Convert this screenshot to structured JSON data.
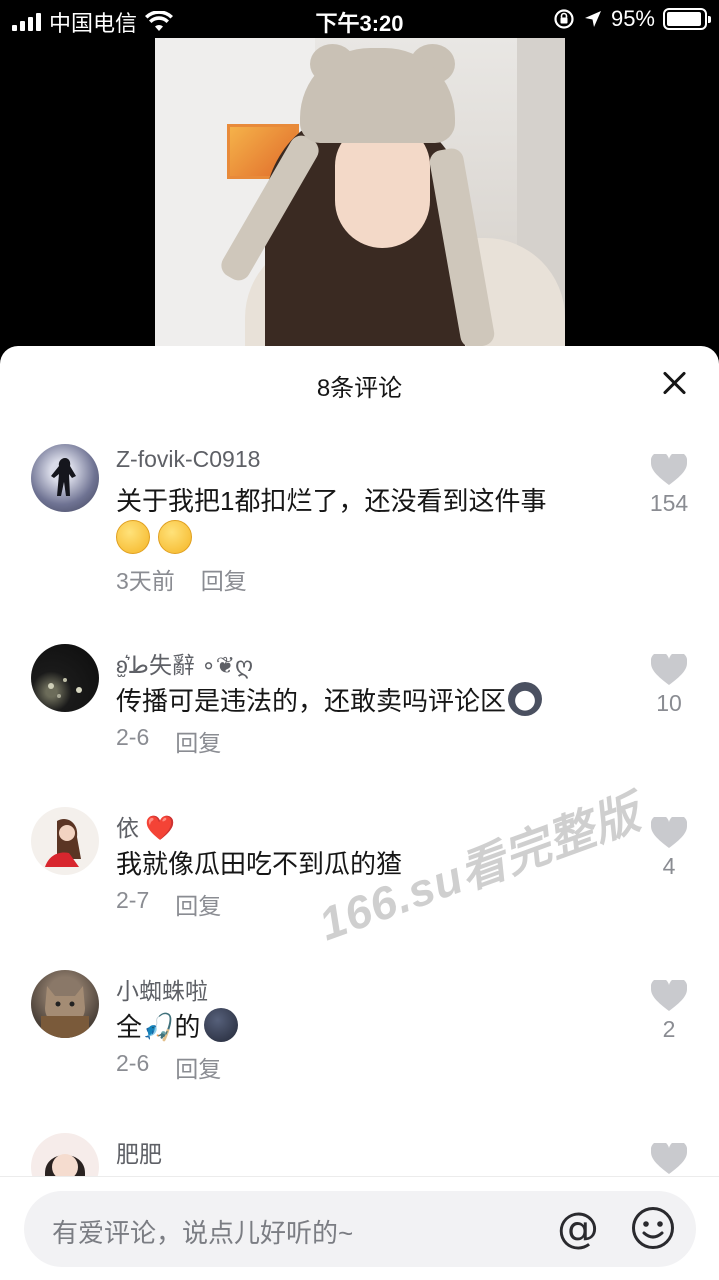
{
  "status_bar": {
    "carrier": "中国电信",
    "time": "下午3:20",
    "battery": "95%",
    "battery_level": 0.95,
    "icons": [
      "signal-icon",
      "wifi-icon",
      "rotation-lock-icon",
      "location-icon",
      "battery-icon"
    ]
  },
  "sheet": {
    "title": "8条评论",
    "close_icon": "close-icon"
  },
  "comments": [
    {
      "username": "Z-fovik-C0918",
      "text": "关于我把1都扣烂了，还没看到这件事",
      "emojis": [
        "pleading-face",
        "pleading-face"
      ],
      "time": "3天前",
      "reply": "回复",
      "likes": "154"
    },
    {
      "username": "ʚ̫͛ط失辭 ∘❦ღ",
      "text": "传播可是违法的，还敢卖吗评论区",
      "emojis": [
        "dog-face"
      ],
      "time": "2-6",
      "reply": "回复",
      "likes": "10"
    },
    {
      "username": "依",
      "username_emoji": "❤️",
      "text": "我就像瓜田吃不到瓜的猹",
      "emojis": [],
      "time": "2-7",
      "reply": "回复",
      "likes": "4"
    },
    {
      "username": "小蜘蛛啦",
      "text_before": "全",
      "text_mid": "🎣",
      "text_after": "的",
      "emojis": [
        "dark-face"
      ],
      "time": "2-6",
      "reply": "回复",
      "likes": "2"
    },
    {
      "username": "肥肥",
      "text": "",
      "time": "",
      "reply": "",
      "likes": ""
    }
  ],
  "watermark": "166.su看完整版",
  "input": {
    "placeholder": "有爱评论，说点儿好听的~",
    "at_symbol": "@"
  },
  "colors": {
    "sheet_bg": "#ffffff",
    "text_primary": "#161616",
    "text_secondary": "#8a8c92",
    "like_heart": "#c9cace",
    "input_bg": "#f2f2f4"
  }
}
